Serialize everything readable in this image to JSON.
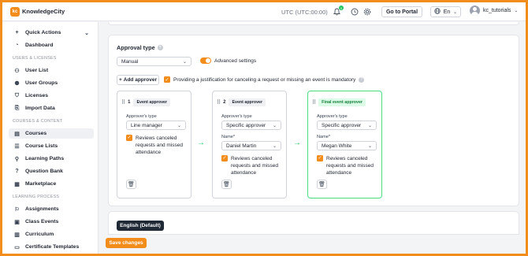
{
  "topbar": {
    "logo_mark": "kc",
    "logo_text": "KnowledgeCity",
    "timezone": "UTC (UTC:00:00)",
    "notification_count": "0",
    "portal_button": "Go to Portal",
    "language": "En",
    "username": "kc_tutorials"
  },
  "sidebar": {
    "quick_actions": "Quick Actions",
    "dashboard": "Dashboard",
    "section_users": "USERS & LICENSES",
    "user_list": "User List",
    "user_groups": "User Groups",
    "licenses": "Licenses",
    "import_data": "Import Data",
    "section_courses": "COURSES & CONTENT",
    "courses": "Courses",
    "course_lists": "Course Lists",
    "learning_paths": "Learning Paths",
    "question_bank": "Question Bank",
    "marketplace": "Marketplace",
    "section_learning": "LEARNING PROCESS",
    "assignments": "Assignments",
    "class_events": "Class Events",
    "curriculum": "Curriculum",
    "certificate_templates": "Certificate Templates"
  },
  "approval": {
    "title": "Approval type",
    "type_value": "Manual",
    "advanced_settings_label": "Advanced settings",
    "advanced_settings_on": true,
    "add_approver": "Add approver",
    "justification_label": "Providing a justification for canceling a request or missing an event is mandatory",
    "justification_checked": true
  },
  "approvers": [
    {
      "number": "1",
      "badge": "Event approver",
      "type_label": "Approver's type",
      "type_value": "Line manager",
      "checkbox_label": "Reviews canceled requests and missed attendance"
    },
    {
      "number": "2",
      "badge": "Event approver",
      "type_label": "Approver's type",
      "type_value": "Specific approver",
      "name_label": "Name*",
      "name_value": "Daniel Martin",
      "checkbox_label": "Reviews canceled requests and missed attendance"
    },
    {
      "badge": "Final event approver",
      "type_label": "Approver's type",
      "type_value": "Specific approver",
      "name_label": "Name*",
      "name_value": "Megan White",
      "checkbox_label": "Reviews canceled requests and missed attendance"
    }
  ],
  "language_tab": "English (Default)",
  "save_button": "Save changes",
  "colors": {
    "accent": "#f28c1a",
    "final_border": "#4ade80",
    "dark_chip": "#1f2a36"
  }
}
